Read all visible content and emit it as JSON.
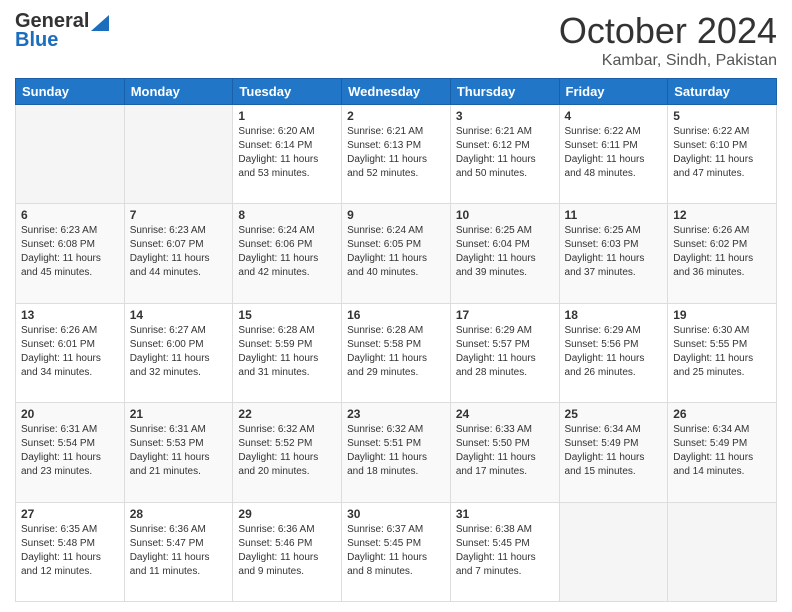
{
  "header": {
    "logo_general": "General",
    "logo_blue": "Blue",
    "month_title": "October 2024",
    "location": "Kambar, Sindh, Pakistan"
  },
  "weekdays": [
    "Sunday",
    "Monday",
    "Tuesday",
    "Wednesday",
    "Thursday",
    "Friday",
    "Saturday"
  ],
  "weeks": [
    [
      {
        "day": "",
        "info": ""
      },
      {
        "day": "",
        "info": ""
      },
      {
        "day": "1",
        "info": "Sunrise: 6:20 AM\nSunset: 6:14 PM\nDaylight: 11 hours and 53 minutes."
      },
      {
        "day": "2",
        "info": "Sunrise: 6:21 AM\nSunset: 6:13 PM\nDaylight: 11 hours and 52 minutes."
      },
      {
        "day": "3",
        "info": "Sunrise: 6:21 AM\nSunset: 6:12 PM\nDaylight: 11 hours and 50 minutes."
      },
      {
        "day": "4",
        "info": "Sunrise: 6:22 AM\nSunset: 6:11 PM\nDaylight: 11 hours and 48 minutes."
      },
      {
        "day": "5",
        "info": "Sunrise: 6:22 AM\nSunset: 6:10 PM\nDaylight: 11 hours and 47 minutes."
      }
    ],
    [
      {
        "day": "6",
        "info": "Sunrise: 6:23 AM\nSunset: 6:08 PM\nDaylight: 11 hours and 45 minutes."
      },
      {
        "day": "7",
        "info": "Sunrise: 6:23 AM\nSunset: 6:07 PM\nDaylight: 11 hours and 44 minutes."
      },
      {
        "day": "8",
        "info": "Sunrise: 6:24 AM\nSunset: 6:06 PM\nDaylight: 11 hours and 42 minutes."
      },
      {
        "day": "9",
        "info": "Sunrise: 6:24 AM\nSunset: 6:05 PM\nDaylight: 11 hours and 40 minutes."
      },
      {
        "day": "10",
        "info": "Sunrise: 6:25 AM\nSunset: 6:04 PM\nDaylight: 11 hours and 39 minutes."
      },
      {
        "day": "11",
        "info": "Sunrise: 6:25 AM\nSunset: 6:03 PM\nDaylight: 11 hours and 37 minutes."
      },
      {
        "day": "12",
        "info": "Sunrise: 6:26 AM\nSunset: 6:02 PM\nDaylight: 11 hours and 36 minutes."
      }
    ],
    [
      {
        "day": "13",
        "info": "Sunrise: 6:26 AM\nSunset: 6:01 PM\nDaylight: 11 hours and 34 minutes."
      },
      {
        "day": "14",
        "info": "Sunrise: 6:27 AM\nSunset: 6:00 PM\nDaylight: 11 hours and 32 minutes."
      },
      {
        "day": "15",
        "info": "Sunrise: 6:28 AM\nSunset: 5:59 PM\nDaylight: 11 hours and 31 minutes."
      },
      {
        "day": "16",
        "info": "Sunrise: 6:28 AM\nSunset: 5:58 PM\nDaylight: 11 hours and 29 minutes."
      },
      {
        "day": "17",
        "info": "Sunrise: 6:29 AM\nSunset: 5:57 PM\nDaylight: 11 hours and 28 minutes."
      },
      {
        "day": "18",
        "info": "Sunrise: 6:29 AM\nSunset: 5:56 PM\nDaylight: 11 hours and 26 minutes."
      },
      {
        "day": "19",
        "info": "Sunrise: 6:30 AM\nSunset: 5:55 PM\nDaylight: 11 hours and 25 minutes."
      }
    ],
    [
      {
        "day": "20",
        "info": "Sunrise: 6:31 AM\nSunset: 5:54 PM\nDaylight: 11 hours and 23 minutes."
      },
      {
        "day": "21",
        "info": "Sunrise: 6:31 AM\nSunset: 5:53 PM\nDaylight: 11 hours and 21 minutes."
      },
      {
        "day": "22",
        "info": "Sunrise: 6:32 AM\nSunset: 5:52 PM\nDaylight: 11 hours and 20 minutes."
      },
      {
        "day": "23",
        "info": "Sunrise: 6:32 AM\nSunset: 5:51 PM\nDaylight: 11 hours and 18 minutes."
      },
      {
        "day": "24",
        "info": "Sunrise: 6:33 AM\nSunset: 5:50 PM\nDaylight: 11 hours and 17 minutes."
      },
      {
        "day": "25",
        "info": "Sunrise: 6:34 AM\nSunset: 5:49 PM\nDaylight: 11 hours and 15 minutes."
      },
      {
        "day": "26",
        "info": "Sunrise: 6:34 AM\nSunset: 5:49 PM\nDaylight: 11 hours and 14 minutes."
      }
    ],
    [
      {
        "day": "27",
        "info": "Sunrise: 6:35 AM\nSunset: 5:48 PM\nDaylight: 11 hours and 12 minutes."
      },
      {
        "day": "28",
        "info": "Sunrise: 6:36 AM\nSunset: 5:47 PM\nDaylight: 11 hours and 11 minutes."
      },
      {
        "day": "29",
        "info": "Sunrise: 6:36 AM\nSunset: 5:46 PM\nDaylight: 11 hours and 9 minutes."
      },
      {
        "day": "30",
        "info": "Sunrise: 6:37 AM\nSunset: 5:45 PM\nDaylight: 11 hours and 8 minutes."
      },
      {
        "day": "31",
        "info": "Sunrise: 6:38 AM\nSunset: 5:45 PM\nDaylight: 11 hours and 7 minutes."
      },
      {
        "day": "",
        "info": ""
      },
      {
        "day": "",
        "info": ""
      }
    ]
  ]
}
